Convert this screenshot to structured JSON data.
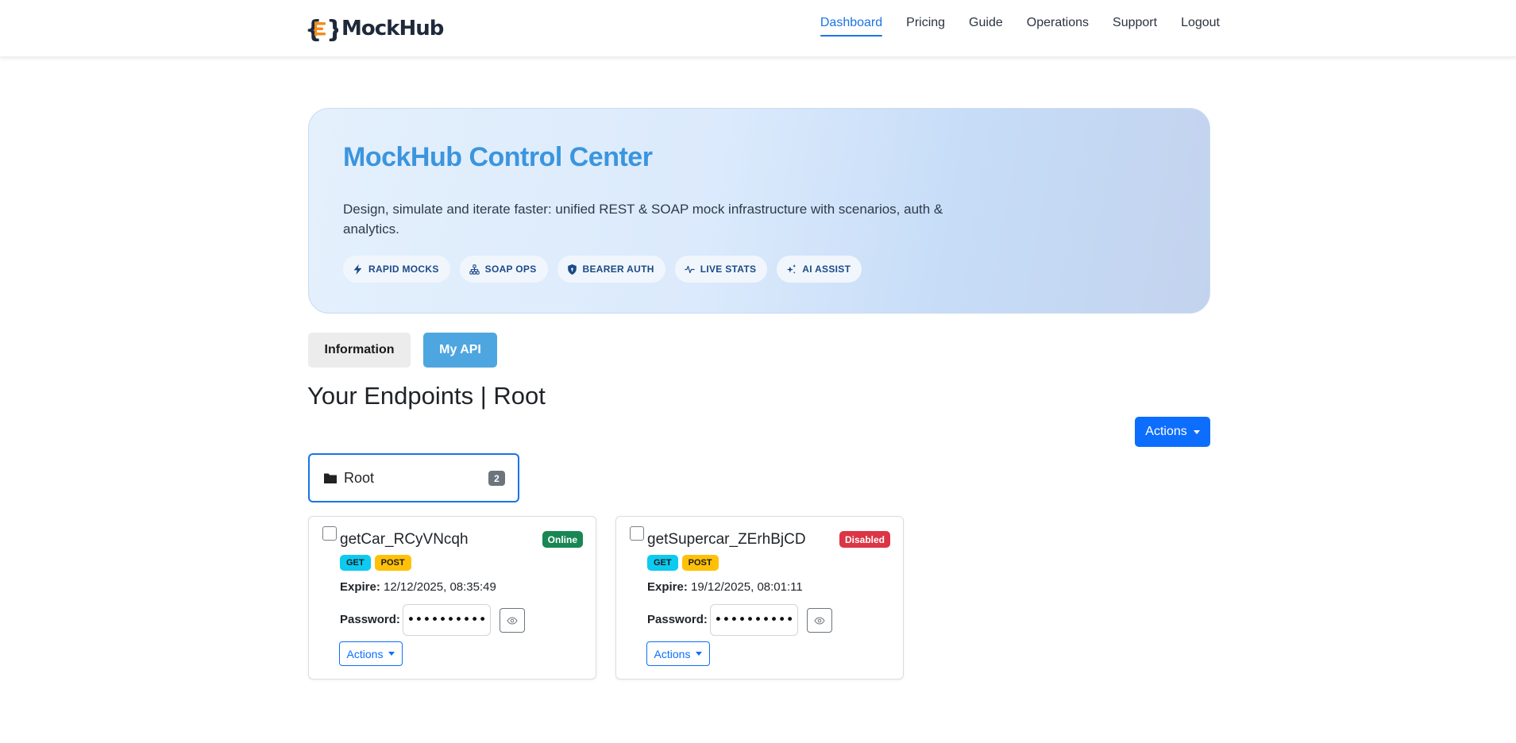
{
  "brand": {
    "name": "MockHub"
  },
  "nav": {
    "items": [
      {
        "label": "Dashboard",
        "active": true
      },
      {
        "label": "Pricing"
      },
      {
        "label": "Guide"
      },
      {
        "label": "Operations"
      },
      {
        "label": "Support"
      },
      {
        "label": "Logout"
      }
    ]
  },
  "hero": {
    "title": "MockHub Control Center",
    "description": "Design, simulate and iterate faster: unified REST & SOAP mock infrastructure with scenarios, auth & analytics.",
    "chips": [
      {
        "label": "RAPID MOCKS",
        "icon": "lightning-icon"
      },
      {
        "label": "SOAP OPS",
        "icon": "sitemap-icon"
      },
      {
        "label": "BEARER AUTH",
        "icon": "shield-icon"
      },
      {
        "label": "LIVE STATS",
        "icon": "activity-icon"
      },
      {
        "label": "AI ASSIST",
        "icon": "sparkles-icon"
      }
    ]
  },
  "tabs": {
    "information": "Information",
    "my_api": "My API"
  },
  "page": {
    "heading": "Your Endpoints | Root",
    "actions_label": "Actions"
  },
  "folder": {
    "name": "Root",
    "count": "2"
  },
  "endpoints": [
    {
      "name": "getCar_RCyVNcqh",
      "status": "Online",
      "methods": [
        "GET",
        "POST"
      ],
      "expire_label": "Expire:",
      "expire_value": "12/12/2025, 08:35:49",
      "password_label": "Password:",
      "password_mask": "••••••••••",
      "actions_label": "Actions"
    },
    {
      "name": "getSupercar_ZErhBjCD",
      "status": "Disabled",
      "methods": [
        "GET",
        "POST"
      ],
      "expire_label": "Expire:",
      "expire_value": "19/12/2025, 08:01:11",
      "password_label": "Password:",
      "password_mask": "••••••••••",
      "actions_label": "Actions"
    }
  ],
  "colors": {
    "accent": "#1a73e8",
    "primary_button": "#0d6efd",
    "hero_title": "#3b95de",
    "online": "#198754",
    "disabled": "#dc3545",
    "method_get": "#0dcaf0",
    "method_post": "#ffc107"
  }
}
